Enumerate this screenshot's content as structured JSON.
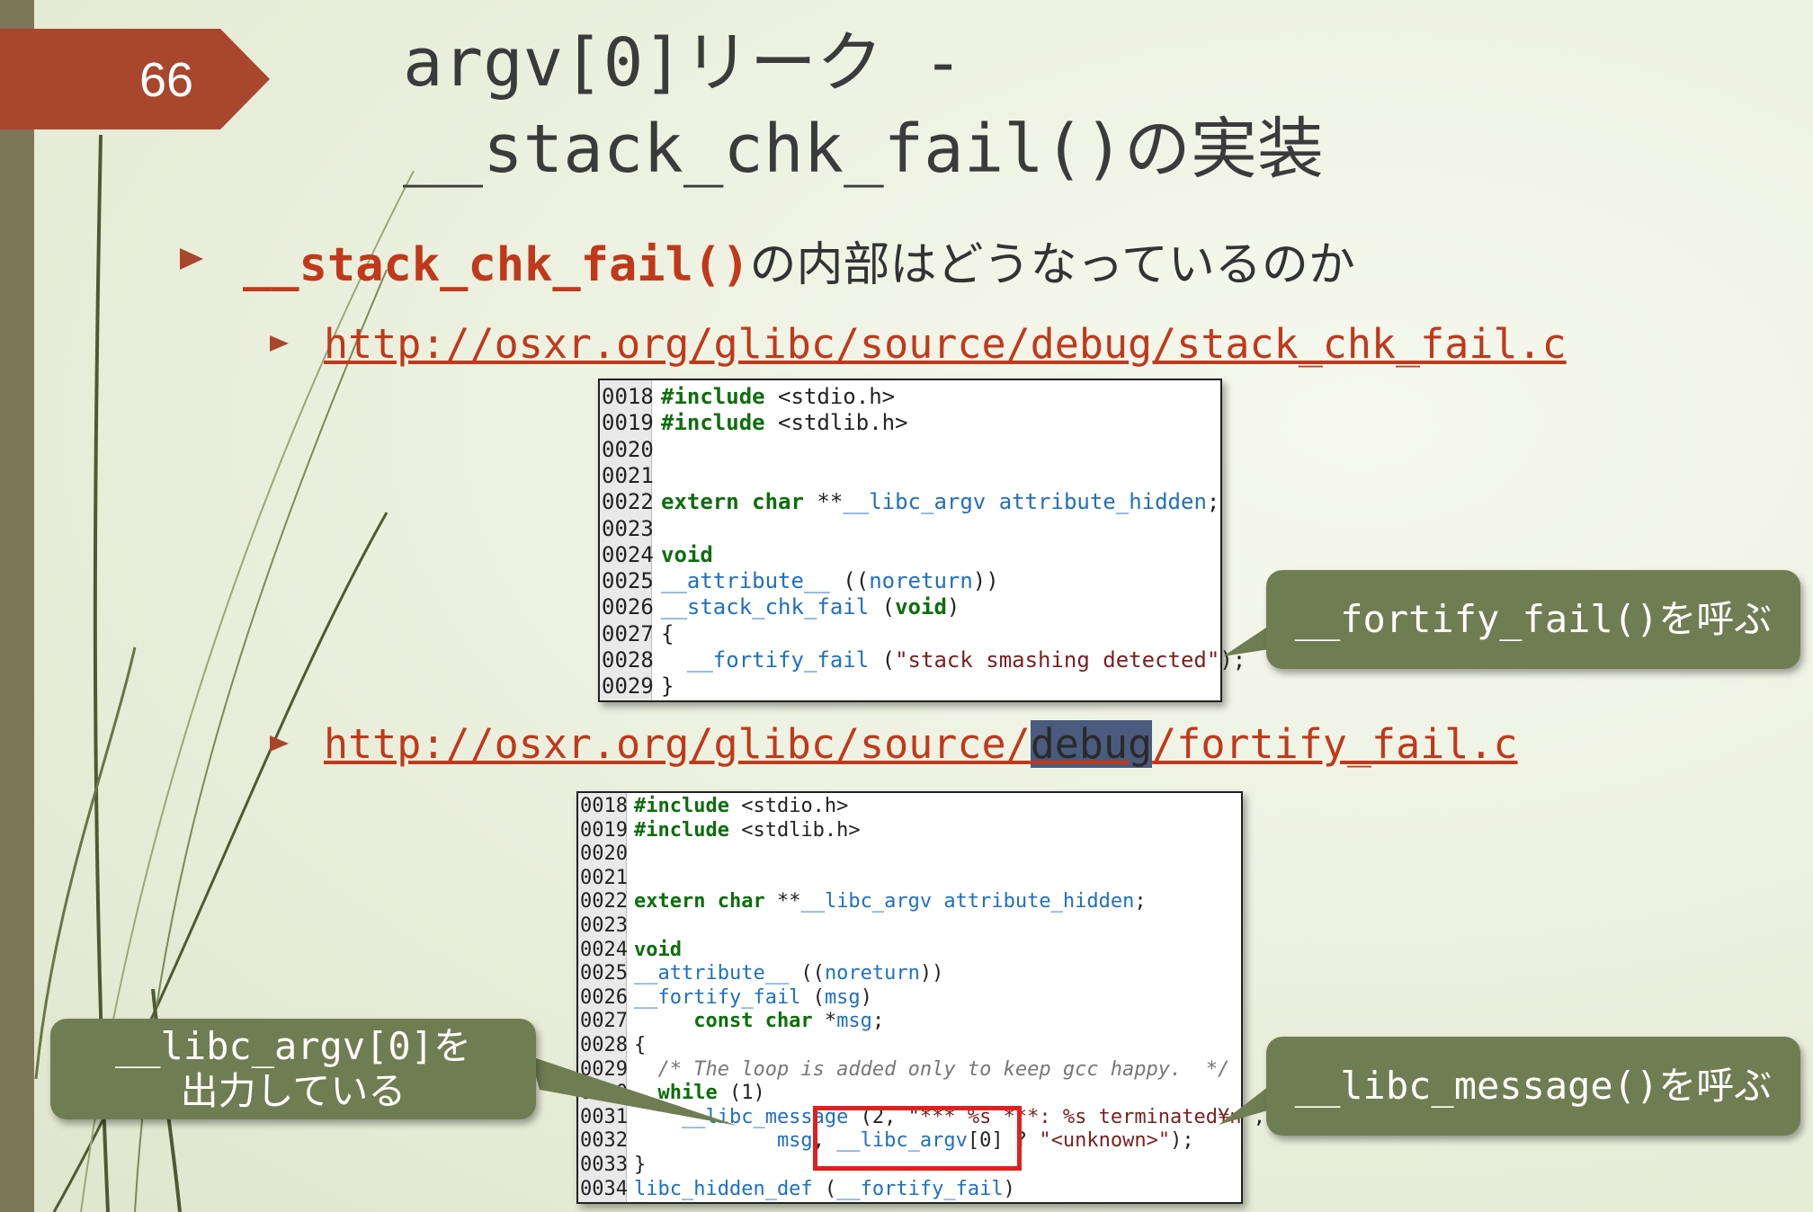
{
  "slide": {
    "page_number": "66",
    "title_line1": "argv[0]リーク -",
    "title_line2": "__stack_chk_fail()の実装"
  },
  "bullet1": {
    "code": "__stack_chk_fail()",
    "text": "の内部はどうなっているのか"
  },
  "link1": "http://osxr.org/glibc/source/debug/stack_chk_fail.c",
  "link2": {
    "before": "http://osxr.org/glibc/source/",
    "highlighted": "debug",
    "after": "/fortify_fail.c"
  },
  "code1": {
    "line_numbers": [
      "0018",
      "0019",
      "0020",
      "0021",
      "0022",
      "0023",
      "0024",
      "0025",
      "0026",
      "0027",
      "0028",
      "0029"
    ],
    "lines": {
      "l18a": "#include",
      "l18b": " <stdio.h>",
      "l19a": "#include",
      "l19b": " <stdlib.h>",
      "l22a": "extern char",
      "l22b": " **",
      "l22c": "__libc_argv attribute_hidden",
      "l22d": ";",
      "l24": "void",
      "l25a": "__attribute__",
      "l25b": " ((",
      "l25c": "noreturn",
      "l25d": "))",
      "l26a": "__stack_chk_fail",
      "l26b": " (",
      "l26c": "void",
      "l26d": ")",
      "l27": "{",
      "l28a": "  __fortify_fail",
      "l28b": " (",
      "l28c": "\"stack smashing detected\"",
      "l28d": ");",
      "l29": "}"
    }
  },
  "code2": {
    "line_numbers": [
      "0018",
      "0019",
      "0020",
      "0021",
      "0022",
      "0023",
      "0024",
      "0025",
      "0026",
      "0027",
      "0028",
      "0029",
      "0030",
      "0031",
      "0032",
      "0033",
      "0034"
    ],
    "lines": {
      "l18a": "#include",
      "l18b": " <stdio.h>",
      "l19a": "#include",
      "l19b": " <stdlib.h>",
      "l22a": "extern char",
      "l22b": " **",
      "l22c": "__libc_argv attribute_hidden",
      "l22d": ";",
      "l24": "void",
      "l25a": "__attribute__",
      "l25b": " ((",
      "l25c": "noreturn",
      "l25d": "))",
      "l26a": "__fortify_fail",
      "l26b": " (",
      "l26c": "msg",
      "l26d": ")",
      "l27a": "     const char",
      "l27b": " *",
      "l27c": "msg",
      "l27d": ";",
      "l28": "{",
      "l29": "  /* The loop is added only to keep gcc happy.  */",
      "l30a": "  while",
      "l30b": " (1)",
      "l31a": "    __libc_message",
      "l31b": " (2, ",
      "l31c": "\"*** %s ***: %s terminated¥n\"",
      "l31d": ",",
      "l32a": "            msg",
      "l32b": ", ",
      "l32c": "__libc_argv",
      "l32d": "[0] ? ",
      "l32e": "\"<unknown>\"",
      "l32f": ");",
      "l33": "}",
      "l34a": "libc_hidden_def",
      "l34b": " (",
      "l34c": "__fortify_fail",
      "l34d": ")"
    }
  },
  "callouts": {
    "fortify": "__fortify_fail()を呼ぶ",
    "argv_line1": "__libc_argv[0]を",
    "argv_line2": "出力している",
    "message": "__libc_message()を呼ぶ"
  },
  "colors": {
    "accent": "#a9472e",
    "link": "#c0391b",
    "callout": "#6e7e52",
    "keyword": "#0c6e0c",
    "identifier": "#1f6fc2",
    "highlight_box": "#e02020"
  }
}
